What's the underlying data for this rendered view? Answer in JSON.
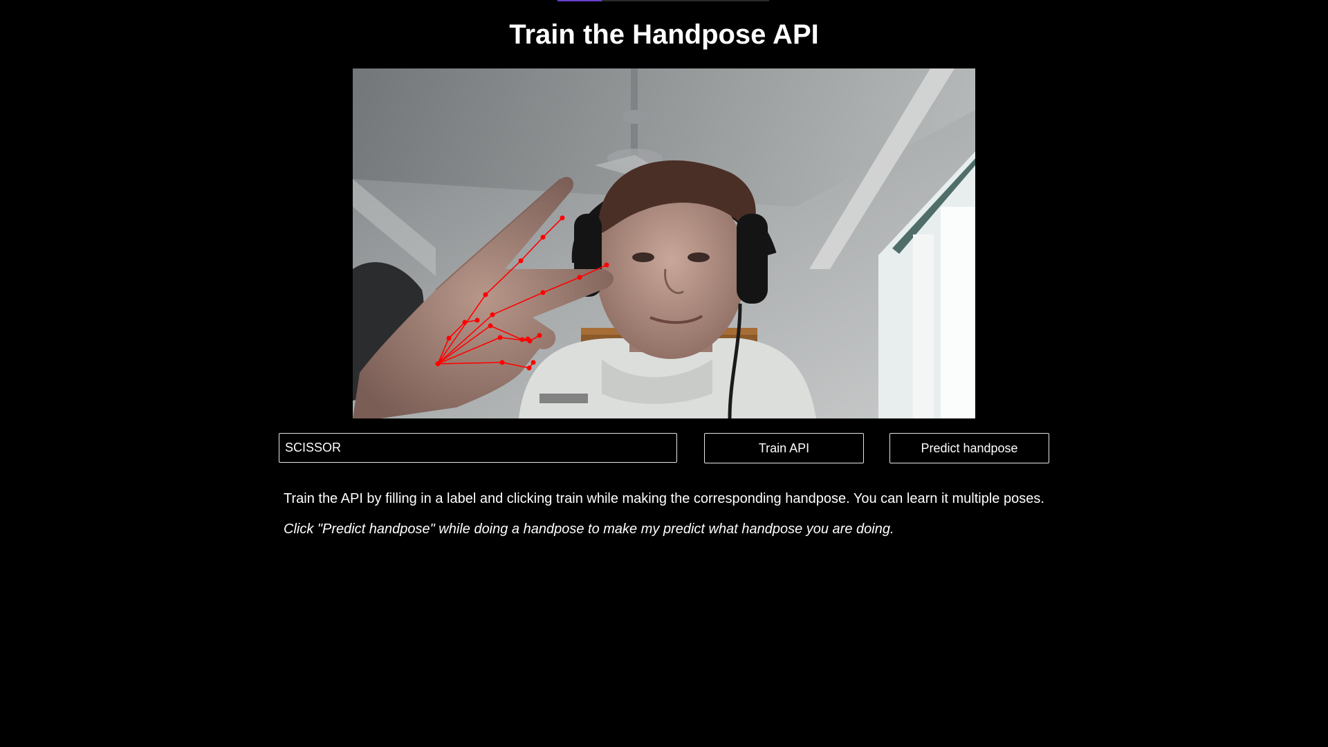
{
  "header": {
    "title": "Train the Handpose API"
  },
  "camera": {
    "description_icon": "webcam-feed",
    "keypoint_color": "#ff0000"
  },
  "controls": {
    "label_value": "SCISSOR",
    "train_label": "Train API",
    "predict_label": "Predict handpose"
  },
  "info": {
    "instructions": "Train the API by filling in a label and clicking train while making the corresponding handpose. You can learn it multiple poses.",
    "hint": "Click \"Predict handpose\" while doing a handpose to make my predict what handpose you are doing."
  }
}
